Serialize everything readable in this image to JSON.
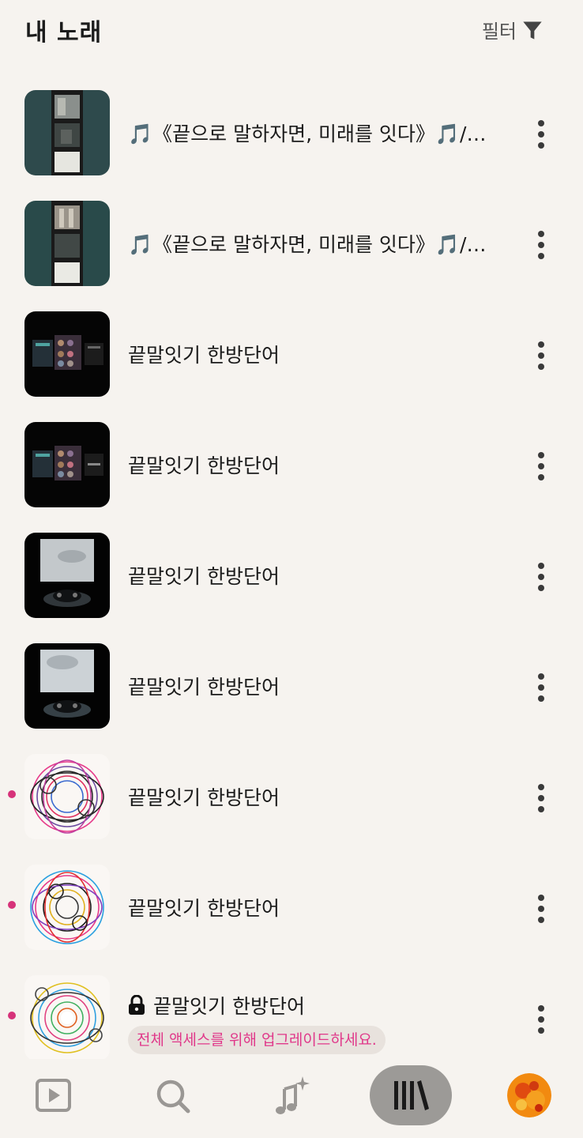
{
  "header": {
    "title": "내 노래",
    "filter_label": "필터"
  },
  "songs": [
    {
      "title": "🎵《끝으로 말하자면, 미래를 잇다》🎵/…",
      "art": "cover-teal-corridor",
      "new": false,
      "locked": false
    },
    {
      "title": "🎵《끝으로 말하자면, 미래를 잇다》🎵/…",
      "art": "cover-teal-corridor",
      "new": false,
      "locked": false
    },
    {
      "title": "끝말잇기 한방단어",
      "art": "cover-dark-screens",
      "new": false,
      "locked": false
    },
    {
      "title": "끝말잇기 한방단어",
      "art": "cover-dark-screens",
      "new": false,
      "locked": false
    },
    {
      "title": "끝말잇기 한방단어",
      "art": "cover-sky-controller",
      "new": false,
      "locked": false
    },
    {
      "title": "끝말잇기 한방단어",
      "art": "cover-sky-controller",
      "new": false,
      "locked": false
    },
    {
      "title": "끝말잇기 한방단어",
      "art": "cover-scribble-circle",
      "new": true,
      "locked": false
    },
    {
      "title": "끝말잇기 한방단어",
      "art": "cover-scribble-circle",
      "new": true,
      "locked": false
    },
    {
      "title": "끝말잇기 한방단어",
      "art": "cover-scribble-colorful",
      "new": true,
      "locked": true,
      "upgrade_label": "전체 액세스를 위해 업그레이드하세요."
    }
  ],
  "nav": {
    "items": [
      {
        "name": "nav-home",
        "icon": "play-square-icon"
      },
      {
        "name": "nav-search",
        "icon": "search-icon"
      },
      {
        "name": "nav-create",
        "icon": "music-sparkle-icon"
      },
      {
        "name": "nav-library",
        "icon": "library-icon",
        "active": true
      },
      {
        "name": "nav-profile",
        "icon": "avatar"
      }
    ]
  },
  "colors": {
    "background": "#f6f3ef",
    "accent_pink": "#e0388a",
    "new_dot": "#d6337a",
    "active_nav": "#9c9a97"
  }
}
